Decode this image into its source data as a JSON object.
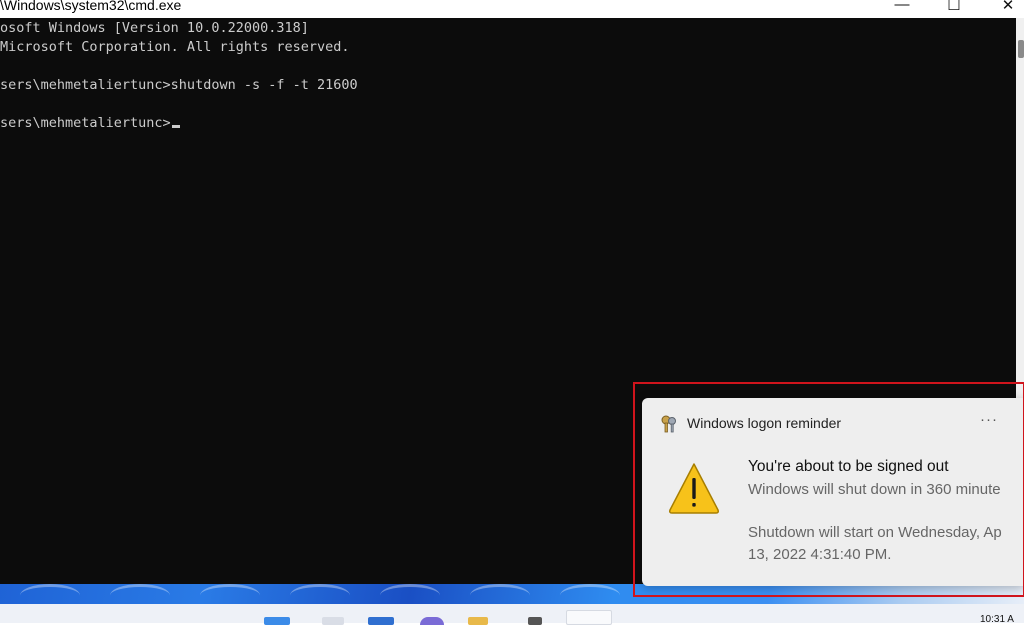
{
  "window": {
    "title": "\\Windows\\system32\\cmd.exe",
    "controls": {
      "minimize": "—",
      "maximize": "☐",
      "close": "✕"
    }
  },
  "console": {
    "lines": [
      "osoft Windows [Version 10.0.22000.318]",
      "Microsoft Corporation. All rights reserved.",
      "sers\\mehmetaliertunc>shutdown -s -f -t 21600",
      "sers\\mehmetaliertunc>"
    ],
    "text_color": "#cccccc",
    "background": "#0c0c0c"
  },
  "notification": {
    "app_name": "Windows logon reminder",
    "more_label": "···",
    "icon": "warning-triangle-icon",
    "app_icon": "keys-icon",
    "heading": "You're about to be signed out",
    "body_line1": "Windows will shut down in 360 minute",
    "body_line2": " Shutdown will start on Wednesday, Ap",
    "body_line3": "13, 2022 4:31:40 PM.",
    "highlight_color": "#d0141c"
  },
  "taskbar": {
    "clock": "10:31 A"
  }
}
